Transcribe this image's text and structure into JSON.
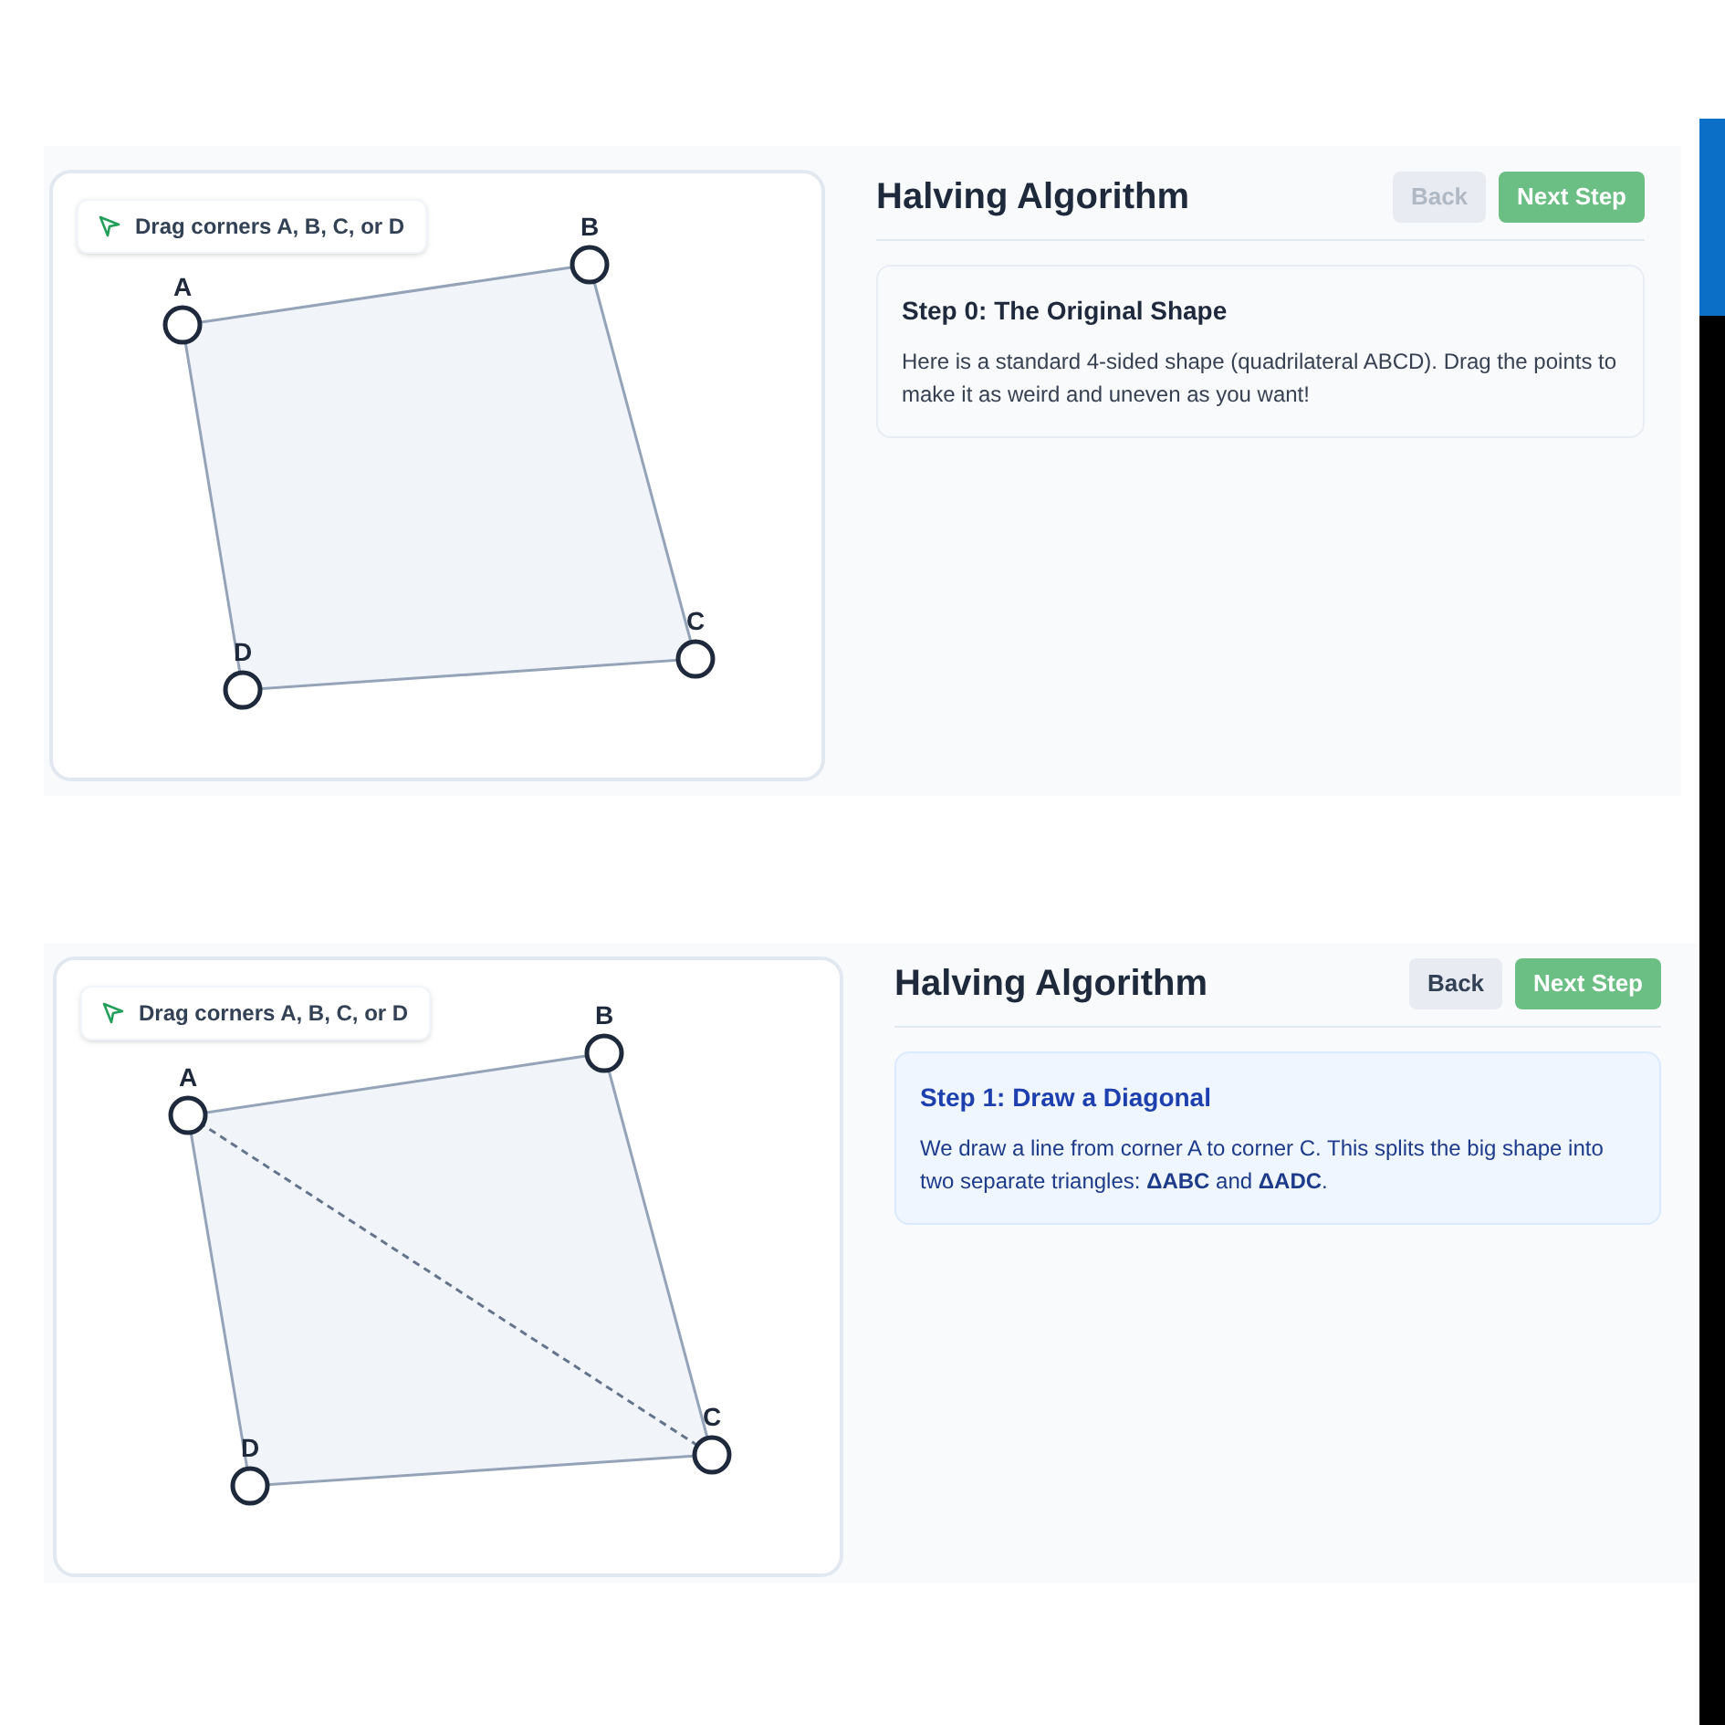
{
  "panels": [
    {
      "hint": "Drag corners A, B, C, or D",
      "title": "Halving Algorithm",
      "back": {
        "label": "Back",
        "disabled": true
      },
      "next": {
        "label": "Next Step"
      },
      "step": {
        "title": "Step 0: The Original Shape",
        "text": "Here is a standard 4-sided shape (quadrilateral ABCD). Drag the points to make it as weird and uneven as you want!",
        "highlighted": false
      },
      "show_diagonal": false,
      "points": [
        {
          "label": "A"
        },
        {
          "label": "B"
        },
        {
          "label": "C"
        },
        {
          "label": "D"
        }
      ]
    },
    {
      "hint": "Drag corners A, B, C, or D",
      "title": "Halving Algorithm",
      "back": {
        "label": "Back",
        "disabled": false
      },
      "next": {
        "label": "Next Step"
      },
      "step": {
        "title": "Step 1: Draw a Diagonal",
        "text": "We draw a line from corner A to corner C. This splits the big shape into two separate triangles: **ΔABC** and **ΔADC**.",
        "highlighted": true
      },
      "show_diagonal": true,
      "points": [
        {
          "label": "A"
        },
        {
          "label": "B"
        },
        {
          "label": "C"
        },
        {
          "label": "D"
        }
      ]
    }
  ]
}
